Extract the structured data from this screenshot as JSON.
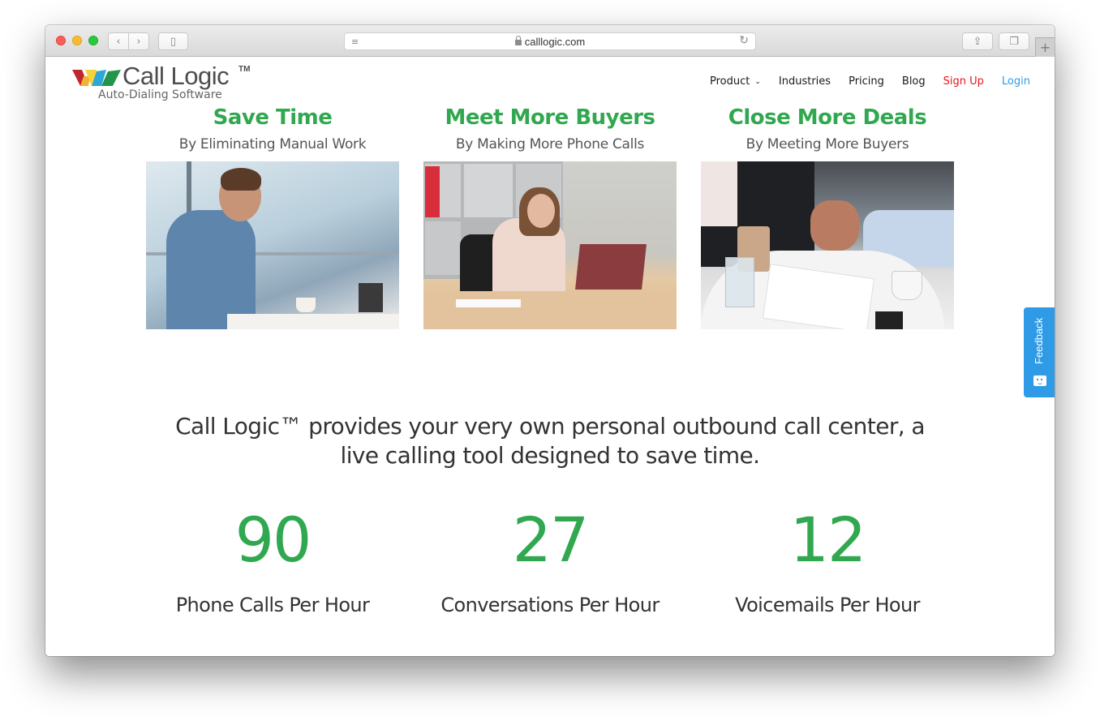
{
  "browser": {
    "url": "calllogic.com",
    "icons": {
      "close": "close-window-icon",
      "minimize": "minimize-window-icon",
      "zoom": "zoom-window-icon",
      "back": "chevron-left-icon",
      "forward": "chevron-right-icon",
      "sidebar": "sidebar-icon",
      "reader": "reader-icon",
      "lock": "lock-icon",
      "reload": "reload-icon",
      "share": "share-icon",
      "tabs": "tabs-icon",
      "new_tab": "plus-icon"
    },
    "glyphs": {
      "back": "‹",
      "forward": "›",
      "sidebar": "▯",
      "reader": "≡",
      "reload": "↻",
      "share": "⇪",
      "tabs": "❐",
      "new_tab": "+"
    }
  },
  "header": {
    "logo": {
      "name": "Call Logic",
      "trademark": "TM",
      "tagline": "Auto-Dialing Software"
    },
    "nav": [
      {
        "label": "Product",
        "has_dropdown": true,
        "chevron": "⌄"
      },
      {
        "label": "Industries"
      },
      {
        "label": "Pricing"
      },
      {
        "label": "Blog"
      },
      {
        "label": "Sign Up",
        "color": "#e8161b"
      },
      {
        "label": "Login",
        "color": "#2f9be6"
      }
    ]
  },
  "features": [
    {
      "title": "Save Time",
      "subtitle": "By Eliminating Manual Work",
      "image_alt": "Man checking smartwatch at cafe table"
    },
    {
      "title": "Meet More Buyers",
      "subtitle": "By Making More Phone Calls",
      "image_alt": "Woman on phone at office desk with laptop"
    },
    {
      "title": "Close More Deals",
      "subtitle": "By Meeting More Buyers",
      "image_alt": "Business handshake over table with coffee and documents"
    }
  ],
  "intro": {
    "line1": "Call Logic™ provides your very own personal outbound call center, a",
    "line2": "live calling tool designed to save time."
  },
  "stats": [
    {
      "value": "90",
      "label": "Phone Calls Per Hour"
    },
    {
      "value": "27",
      "label": "Conversations Per Hour"
    },
    {
      "value": "12",
      "label": "Voicemails Per Hour"
    }
  ],
  "feedback": {
    "label": "Feedback"
  },
  "colors": {
    "accent_green": "#31a84f",
    "signup_red": "#e8161b",
    "login_blue": "#2f9be6",
    "feedback_blue": "#2f9be6"
  }
}
